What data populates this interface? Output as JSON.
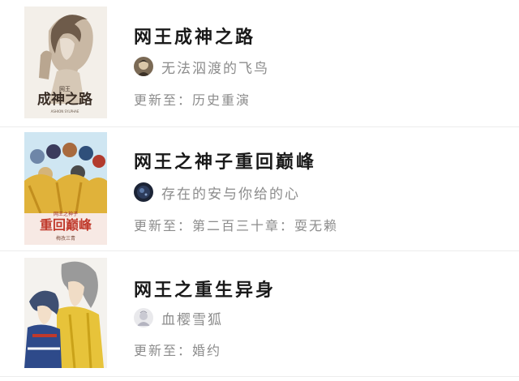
{
  "update_prefix": "更新至：",
  "books": [
    {
      "title": "网王成神之路",
      "author": "无法泅渡的飞鸟",
      "latest_chapter": "历史重演",
      "cover_art_text": "成神之路",
      "cover_art_small": "网王",
      "cover_art_author": "ASHION SYLPHAE",
      "cover_icon": "book-cover-1",
      "avatar_icon": "author-avatar-1"
    },
    {
      "title": "网王之神子重回巅峰",
      "author": "存在的安与你给的心",
      "latest_chapter": "第二百三十章：耍无赖",
      "cover_art_text": "重回巅峰",
      "cover_art_small": "网王之神子",
      "cover_art_author": "梅孜三青",
      "cover_icon": "book-cover-2",
      "avatar_icon": "author-avatar-2"
    },
    {
      "title": "网王之重生异身",
      "author": "血樱雪狐",
      "latest_chapter": "婚约",
      "cover_icon": "book-cover-3",
      "avatar_icon": "author-avatar-3"
    }
  ]
}
